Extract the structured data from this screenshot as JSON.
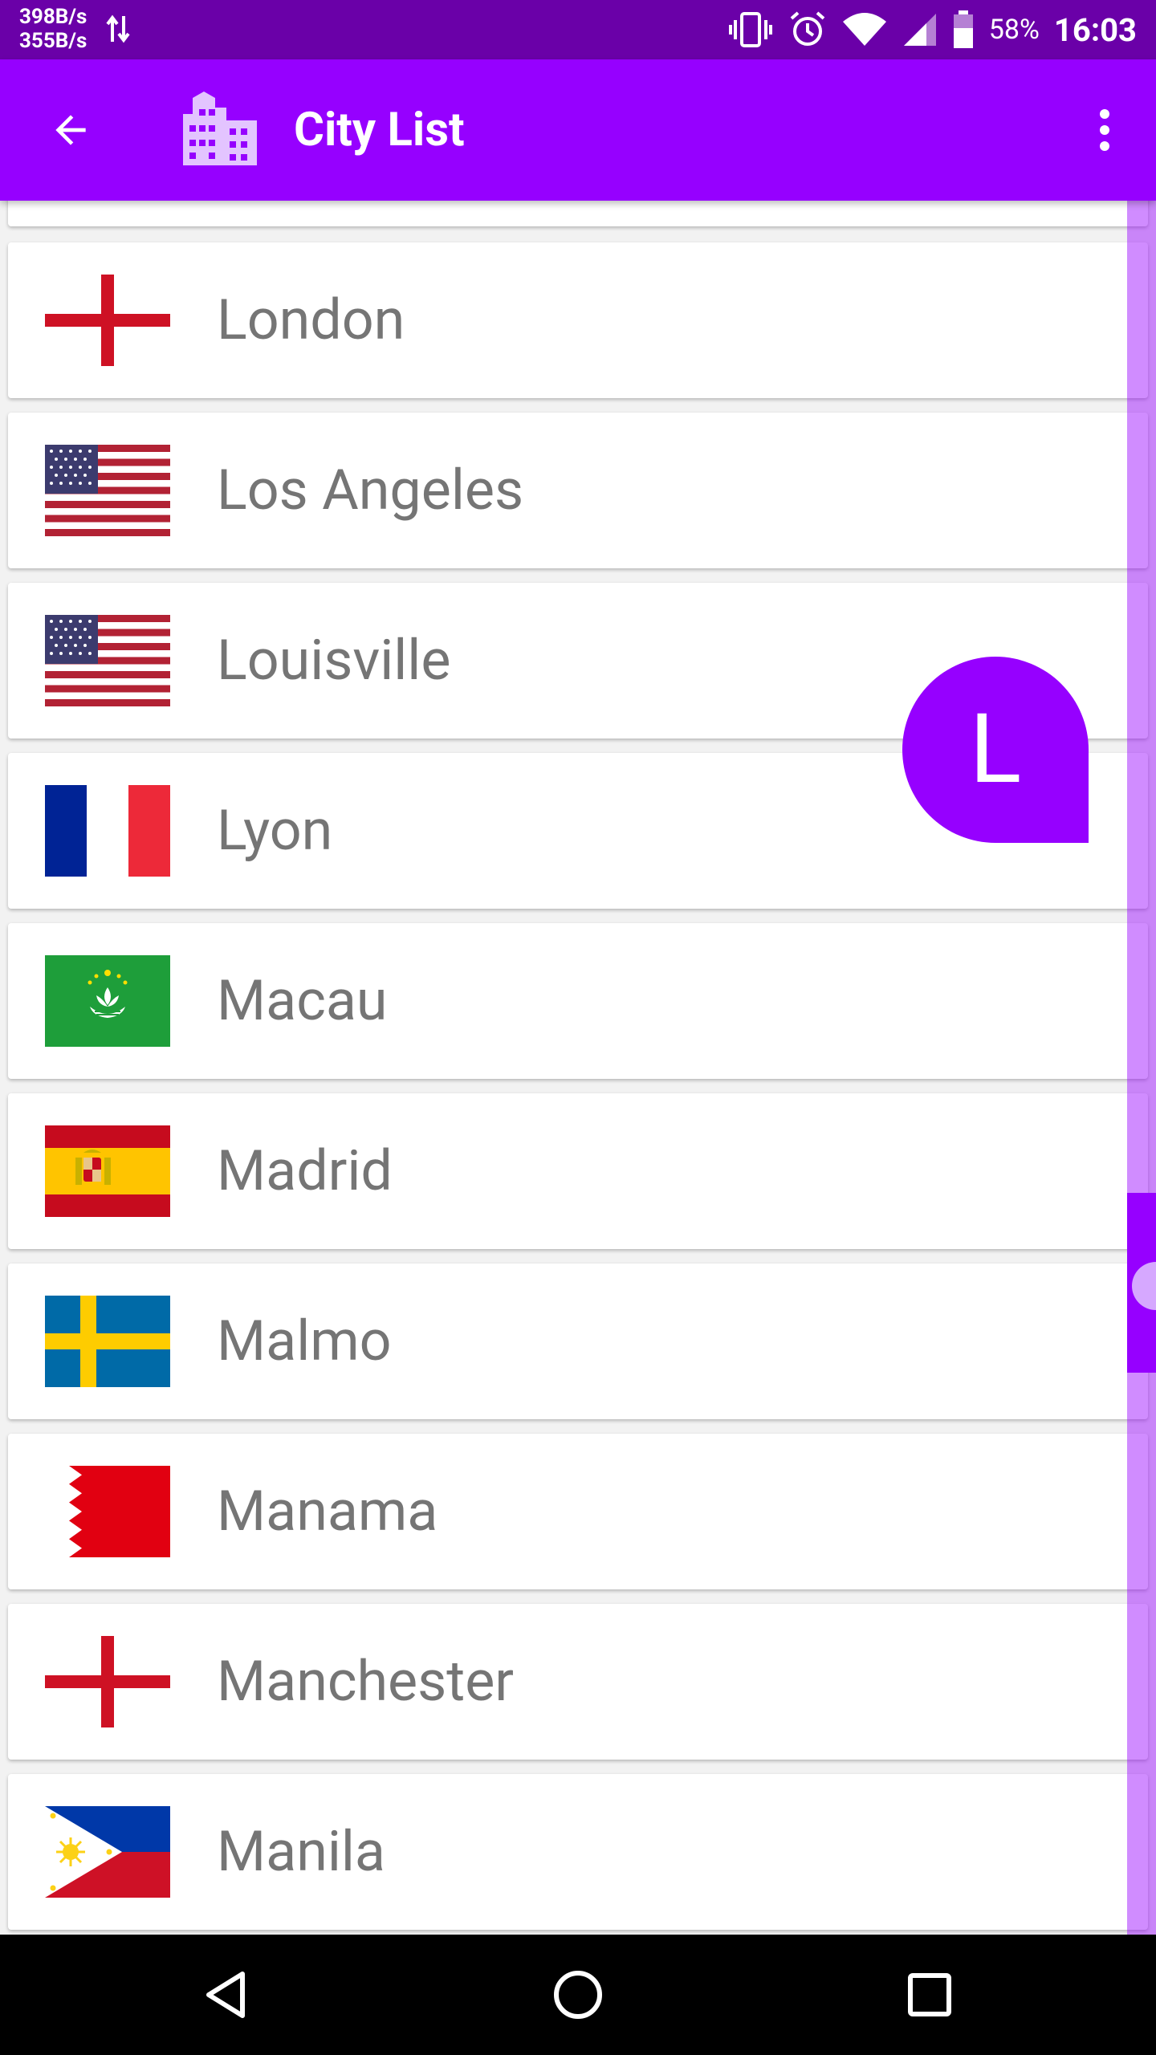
{
  "status_bar": {
    "net_up": "398B/s",
    "net_down": "355B/s",
    "battery_percent": "58%",
    "time": "16:03"
  },
  "app_bar": {
    "title": "City List"
  },
  "cities": [
    {
      "name": "London",
      "flag": "england-flag-icon"
    },
    {
      "name": "Los Angeles",
      "flag": "usa-flag-icon"
    },
    {
      "name": "Louisville",
      "flag": "usa-flag-icon"
    },
    {
      "name": "Lyon",
      "flag": "france-flag-icon"
    },
    {
      "name": "Macau",
      "flag": "macau-flag-icon"
    },
    {
      "name": "Madrid",
      "flag": "spain-flag-icon"
    },
    {
      "name": "Malmo",
      "flag": "sweden-flag-icon"
    },
    {
      "name": "Manama",
      "flag": "bahrain-flag-icon"
    },
    {
      "name": "Manchester",
      "flag": "england-flag-icon"
    },
    {
      "name": "Manila",
      "flag": "philippines-flag-icon"
    }
  ],
  "index_bubble": {
    "letter": "L"
  },
  "colors": {
    "primary": "#9600ff",
    "status_bar": "#6a00a8",
    "text_secondary": "#757575"
  }
}
